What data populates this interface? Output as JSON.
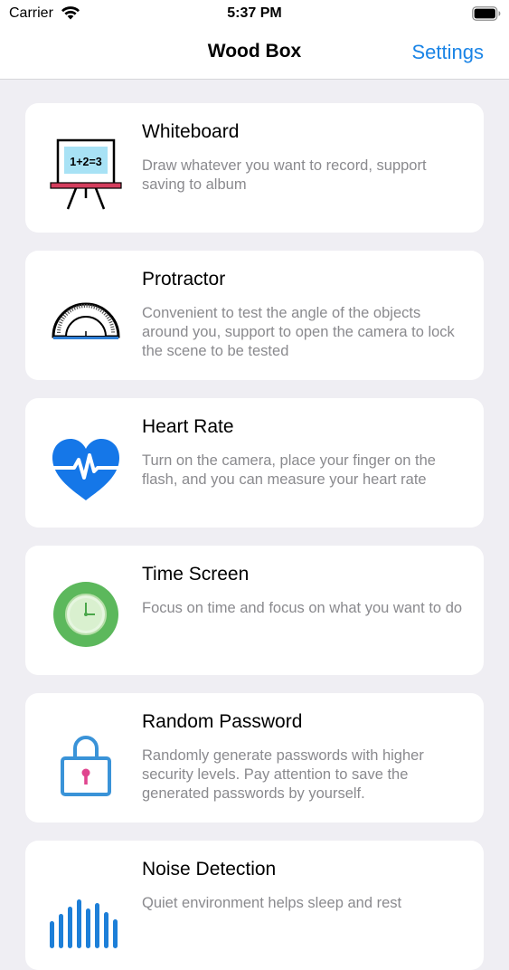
{
  "status_bar": {
    "carrier": "Carrier",
    "time": "5:37 PM"
  },
  "nav": {
    "title": "Wood Box",
    "settings_label": "Settings"
  },
  "colors": {
    "accent": "#1a84e6",
    "background": "#efeef3",
    "card": "#ffffff",
    "secondary_text": "#8a8a8e"
  },
  "tools": [
    {
      "icon": "whiteboard-icon",
      "icon_text": "1+2=3",
      "title": "Whiteboard",
      "description": "Draw whatever you want to record, support saving to album"
    },
    {
      "icon": "protractor-icon",
      "title": "Protractor",
      "description": "Convenient to test the angle of the objects around you, support to open the camera to lock the scene to be tested"
    },
    {
      "icon": "heart-rate-icon",
      "title": "Heart Rate",
      "description": "Turn on the camera, place your finger on the flash, and you can measure your heart rate"
    },
    {
      "icon": "clock-icon",
      "title": "Time Screen",
      "description": "Focus on time and focus on what you want to do"
    },
    {
      "icon": "lock-icon",
      "title": "Random Password",
      "description": "Randomly generate passwords with higher security levels. Pay attention to save the generated passwords by yourself."
    },
    {
      "icon": "sound-wave-icon",
      "title": "Noise Detection",
      "description": "Quiet environment helps sleep and rest"
    }
  ]
}
